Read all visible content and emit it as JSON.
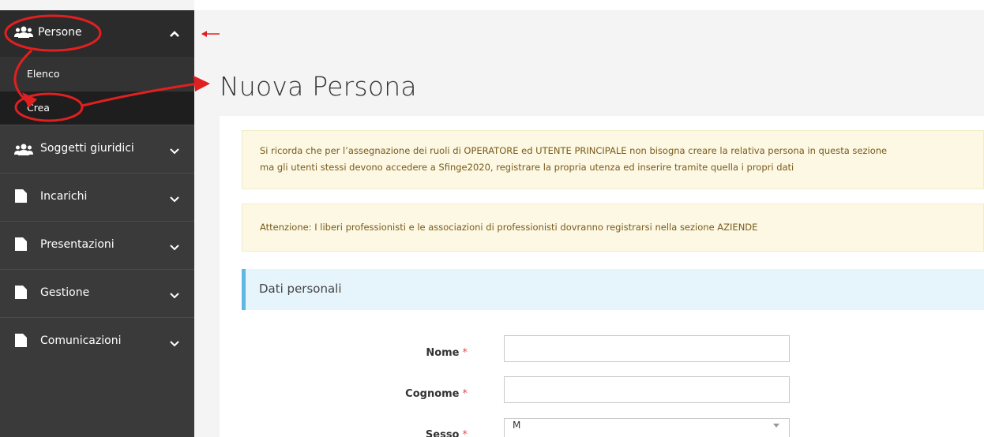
{
  "sidebar": {
    "header": {
      "label": "Persone",
      "icon": "users-icon"
    },
    "submenu": [
      {
        "label": "Elenco"
      },
      {
        "label": "Crea"
      }
    ],
    "items": [
      {
        "label": "Soggetti giuridici",
        "icon": "users-icon"
      },
      {
        "label": "Incarichi",
        "icon": "document-icon"
      },
      {
        "label": "Presentazioni",
        "icon": "document-icon"
      },
      {
        "label": "Gestione",
        "icon": "document-icon"
      },
      {
        "label": "Comunicazioni",
        "icon": "document-icon"
      }
    ]
  },
  "main": {
    "title": "Nuova Persona",
    "alert1": {
      "line1": "Si ricorda che per l’assegnazione dei ruoli di OPERATORE ed UTENTE PRINCIPALE non bisogna creare la relativa persona in questa sezione",
      "line2": "ma gli utenti stessi devono accedere a Sfinge2020, registrare la propria utenza ed inserire tramite quella i propri dati"
    },
    "alert2": "Attenzione: I liberi professionisti e le associazioni di professionisti dovranno registrarsi nella sezione AZIENDE",
    "section_title": "Dati personali",
    "form": {
      "required_marker": "*",
      "nome_label": "Nome",
      "nome_value": "",
      "cognome_label": "Cognome",
      "cognome_value": "",
      "sesso_label": "Sesso",
      "sesso_value": "M"
    }
  },
  "colors": {
    "sidebar_bg": "#3a3a3a",
    "annotation_red": "#e02020",
    "alert_bg": "#fcf8e3",
    "section_accent": "#5fb8e4"
  }
}
